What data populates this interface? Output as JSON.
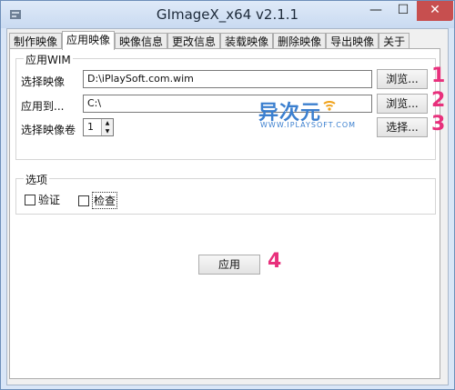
{
  "window": {
    "title": "GImageX_x64 v2.1.1",
    "icon": "tools-icon"
  },
  "titlebar_controls": {
    "minimize": "—",
    "maximize": "☐",
    "close": "✕"
  },
  "tabs": [
    {
      "label": "制作映像",
      "active": false
    },
    {
      "label": "应用映像",
      "active": true
    },
    {
      "label": "映像信息",
      "active": false
    },
    {
      "label": "更改信息",
      "active": false
    },
    {
      "label": "装载映像",
      "active": false
    },
    {
      "label": "删除映像",
      "active": false
    },
    {
      "label": "导出映像",
      "active": false
    },
    {
      "label": "关于",
      "active": false
    }
  ],
  "apply_wim": {
    "group_title": "应用WIM",
    "select_image_label": "选择映像",
    "select_image_value": "D:\\iPlaySoft.com.wim",
    "apply_to_label": "应用到...",
    "apply_to_value": "C:\\",
    "select_volume_label": "选择映像卷",
    "volume_value": "1",
    "browse1_label": "浏览...",
    "browse2_label": "浏览...",
    "choose_label": "选择..."
  },
  "options": {
    "group_title": "选项",
    "verify_label": "验证",
    "check_label": "检查"
  },
  "apply_button_label": "应用",
  "annotations": [
    "1",
    "2",
    "3",
    "4"
  ],
  "watermark": {
    "main": "异次元",
    "sub": "WWW.IPLAYSOFT.COM"
  },
  "colors": {
    "annotation": "#e8307c",
    "watermark": "#3b7fcf"
  }
}
